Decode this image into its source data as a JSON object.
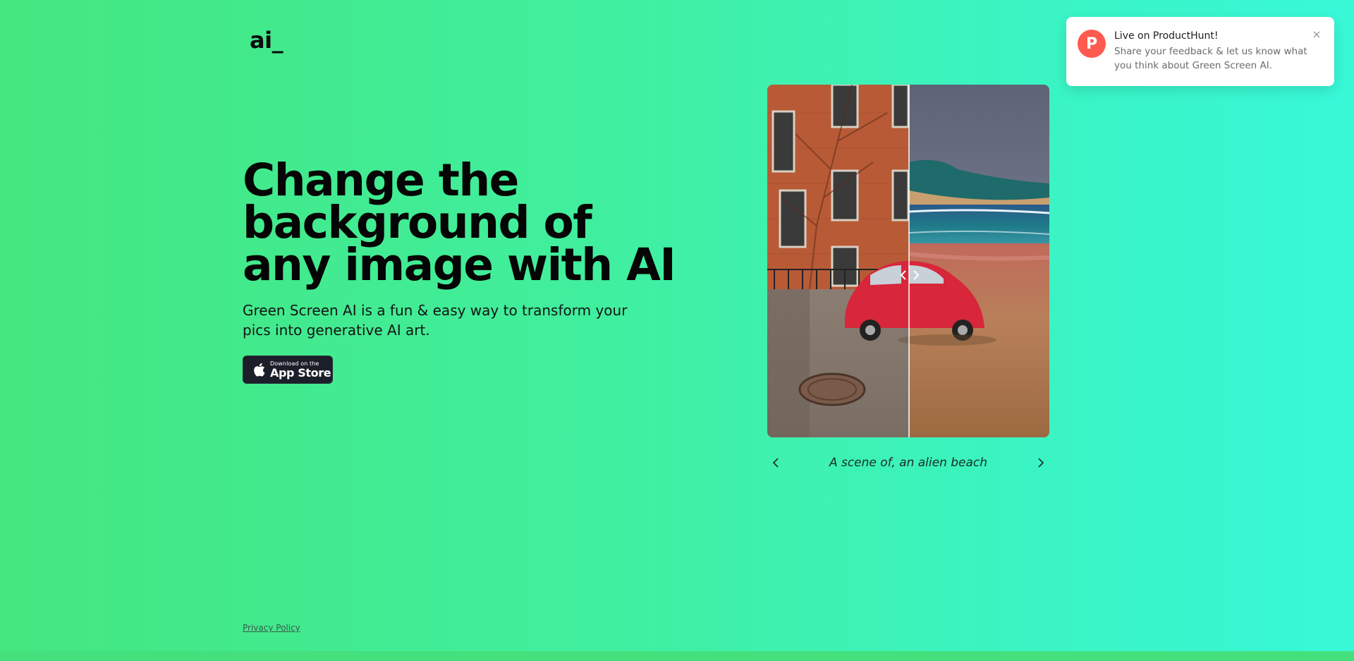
{
  "logo": {
    "text": "ai_"
  },
  "hero": {
    "title": "Change the background of any image with AI",
    "subtitle": "Green Screen AI is a fun & easy way to transform your pics into generative AI art."
  },
  "app_store": {
    "small_label": "Download on the",
    "big_label": "App Store",
    "icon": "apple-icon"
  },
  "carousel": {
    "caption": "A scene of, an alien beach",
    "prev_icon": "chevron-left-icon",
    "next_icon": "chevron-right-icon",
    "slider_handle_icon": "compare-handle-icon"
  },
  "footer": {
    "privacy_link": "Privacy Policy"
  },
  "toast": {
    "badge_letter": "P",
    "title": "Live on ProductHunt!",
    "message": "Share your feedback & let us know what you think about Green Screen AI.",
    "close_icon": "close-icon",
    "badge_color": "#ff5a4f"
  },
  "colors": {
    "background_start": "#44e67f",
    "background_end": "#38f8d8",
    "button_dark": "#1c1f2a"
  }
}
